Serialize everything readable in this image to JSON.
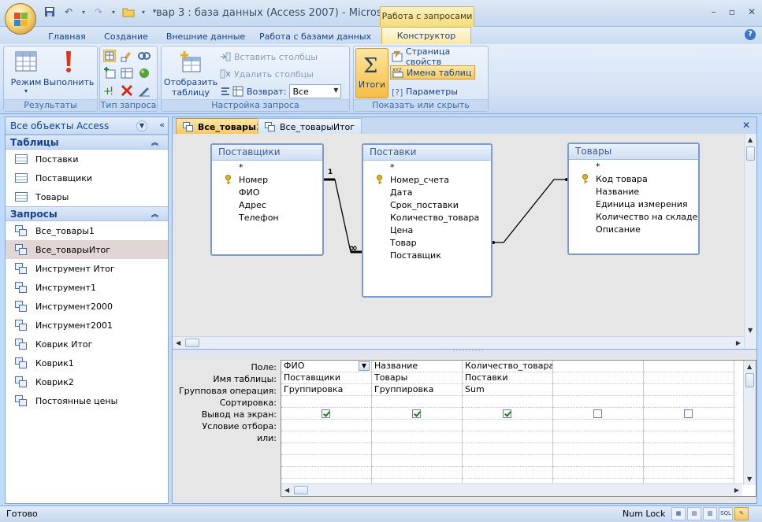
{
  "window": {
    "title": "вар 3 : база данных (Access 2007) - Micros...",
    "context_tab": "Работа с запросами"
  },
  "ribbon_tabs": [
    "Главная",
    "Создание",
    "Внешние данные",
    "Работа с базами данных",
    "Конструктор"
  ],
  "ribbon": {
    "results": {
      "label": "Результаты",
      "mode": "Режим",
      "run": "Выполнить"
    },
    "query_type": {
      "label": "Тип запроса"
    },
    "setup": {
      "label": "Настройка запроса",
      "show_table": "Отобразить таблицу",
      "insert_columns": "Вставить столбцы",
      "delete_columns": "Удалить столбцы",
      "return_label": "Возврат:",
      "return_value": "Все"
    },
    "show_hide": {
      "label": "Показать или скрыть",
      "totals": "Итоги",
      "property_sheet": "Страница свойств",
      "table_names": "Имена таблиц",
      "parameters": "Параметры"
    }
  },
  "nav": {
    "header": "Все объекты Access",
    "tables_group": "Таблицы",
    "tables": [
      "Поставки",
      "Поставщики",
      "Товары"
    ],
    "queries_group": "Запросы",
    "queries": [
      "Все_товары1",
      "Все_товарыИтог",
      "Инструмент Итог",
      "Инструмент1",
      "Инструмент2000",
      "Инструмент2001",
      "Коврик Итог",
      "Коврик1",
      "Коврик2",
      "Постоянные цены"
    ]
  },
  "doc_tabs": [
    "Все_товары1",
    "Все_товарыИтог"
  ],
  "diagram": {
    "tables": [
      {
        "name": "Поставщики",
        "fields": [
          "*",
          "Номер",
          "ФИО",
          "Адрес",
          "Телефон"
        ]
      },
      {
        "name": "Поставки",
        "fields": [
          "*",
          "Номер_счета",
          "Дата",
          "Срок_поставки",
          "Количество_товара",
          "Цена",
          "Товар",
          "Поставщик"
        ]
      },
      {
        "name": "Товары",
        "fields": [
          "*",
          "Код товара",
          "Название",
          "Единица измерения",
          "Количество на складе",
          "Описание"
        ]
      }
    ],
    "rel_one": "1",
    "rel_many": "∞"
  },
  "grid": {
    "row_labels": [
      "Поле:",
      "Имя таблицы:",
      "Групповая операция:",
      "Сортировка:",
      "Вывод на экран:",
      "Условие отбора:",
      "или:"
    ],
    "columns": [
      {
        "field": "ФИО",
        "table": "Поставщики",
        "total": "Группировка",
        "show": true
      },
      {
        "field": "Название",
        "table": "Товары",
        "total": "Группировка",
        "show": true
      },
      {
        "field": "Количество_товара",
        "table": "Поставки",
        "total": "Sum",
        "show": true
      },
      {
        "field": "",
        "table": "",
        "total": "",
        "show": false
      },
      {
        "field": "",
        "table": "",
        "total": "",
        "show": false
      }
    ]
  },
  "status": {
    "text": "Готово",
    "numlock": "Num Lock"
  }
}
